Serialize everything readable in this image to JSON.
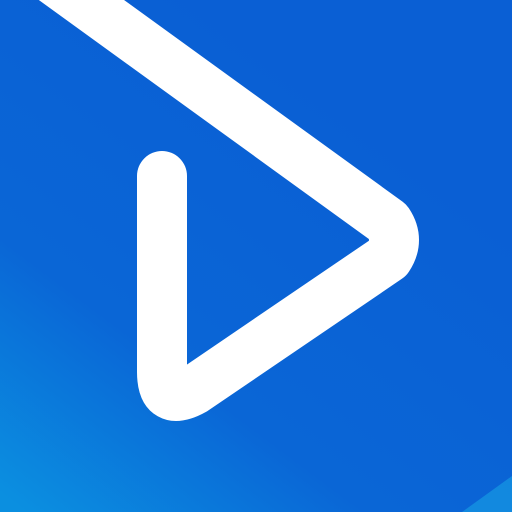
{
  "icon": {
    "name": "play-icon",
    "colors": {
      "background_top": "#0a5fd4",
      "background_bottom": "#0b8fe0",
      "stroke": "#ffffff",
      "corner_accent": "#1aa8e8"
    }
  }
}
